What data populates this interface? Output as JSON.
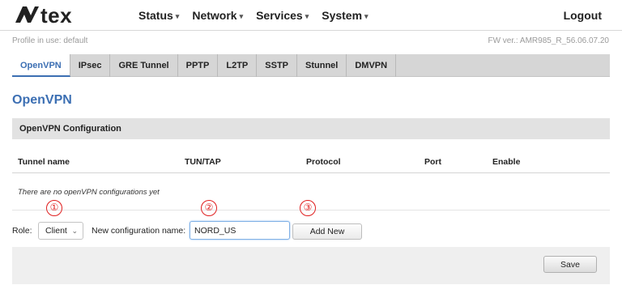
{
  "brand": {
    "logo_text": "Avtex",
    "logo_color": "#222222"
  },
  "nav": {
    "items": [
      {
        "label": "Status"
      },
      {
        "label": "Network"
      },
      {
        "label": "Services"
      },
      {
        "label": "System"
      }
    ],
    "logout": "Logout"
  },
  "info": {
    "profile": "Profile in use: default",
    "firmware": "FW ver.: AMR985_R_56.06.07.20"
  },
  "tabs": [
    {
      "label": "OpenVPN",
      "active": true
    },
    {
      "label": "IPsec"
    },
    {
      "label": "GRE Tunnel"
    },
    {
      "label": "PPTP"
    },
    {
      "label": "L2TP"
    },
    {
      "label": "SSTP"
    },
    {
      "label": "Stunnel"
    },
    {
      "label": "DMVPN"
    }
  ],
  "page_title": "OpenVPN",
  "section": {
    "title": "OpenVPN Configuration",
    "columns": [
      "Tunnel name",
      "TUN/TAP",
      "Protocol",
      "Port",
      "Enable"
    ],
    "empty_message": "There are no openVPN configurations yet"
  },
  "add_form": {
    "role_label": "Role:",
    "role_value": "Client",
    "name_label": "New configuration name:",
    "name_value": "NORD_US",
    "add_button": "Add New"
  },
  "annotations": [
    "①",
    "②",
    "③"
  ],
  "footer": {
    "save_button": "Save"
  },
  "colors": {
    "accent": "#3c6fb3",
    "annotation": "#e02020"
  }
}
